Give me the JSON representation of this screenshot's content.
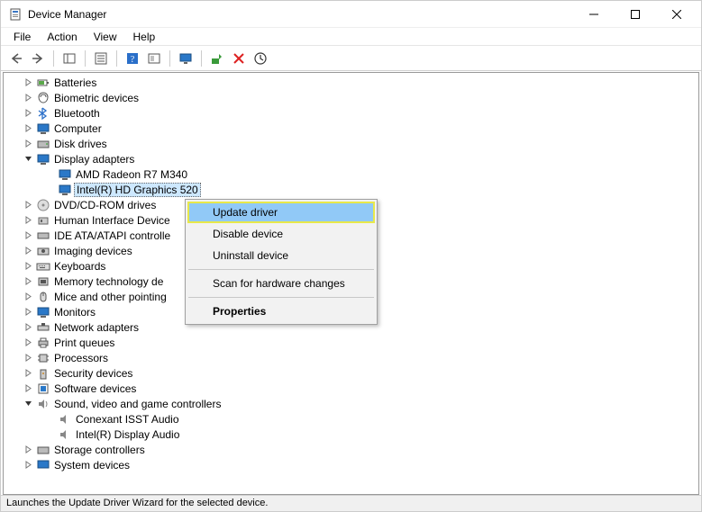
{
  "window": {
    "title": "Device Manager"
  },
  "menu": {
    "file": "File",
    "action": "Action",
    "view": "View",
    "help": "Help"
  },
  "tree": {
    "batteries": "Batteries",
    "biometric": "Biometric devices",
    "bluetooth": "Bluetooth",
    "computer": "Computer",
    "diskdrives": "Disk drives",
    "display": "Display adapters",
    "display_children": {
      "amd": "AMD Radeon R7 M340",
      "intel": "Intel(R) HD Graphics 520"
    },
    "dvd": "DVD/CD-ROM drives",
    "hid": "Human Interface Device",
    "ide": "IDE ATA/ATAPI controlle",
    "imaging": "Imaging devices",
    "keyboards": "Keyboards",
    "memtech": "Memory technology de",
    "mice": "Mice and other pointing",
    "monitors": "Monitors",
    "network": "Network adapters",
    "printqueues": "Print queues",
    "processors": "Processors",
    "security": "Security devices",
    "software": "Software devices",
    "sound": "Sound, video and game controllers",
    "sound_children": {
      "conexant": "Conexant ISST Audio",
      "intel_audio": "Intel(R) Display Audio"
    },
    "storage": "Storage controllers",
    "system": "System devices"
  },
  "context_menu": {
    "update": "Update driver",
    "disable": "Disable device",
    "uninstall": "Uninstall device",
    "scan": "Scan for hardware changes",
    "properties": "Properties"
  },
  "statusbar": {
    "text": "Launches the Update Driver Wizard for the selected device."
  }
}
